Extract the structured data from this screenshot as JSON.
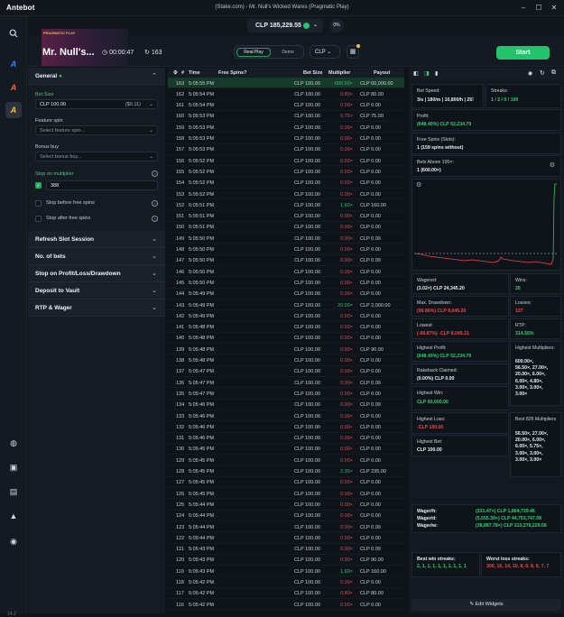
{
  "window": {
    "app_logo": "Antebot",
    "title": "(Stake.com) - Mr. Null's Wicked Wares (Pragmatic Play)"
  },
  "balance": {
    "amount": "CLP 185,229.55",
    "percent_button": "0%"
  },
  "rail": {
    "icons": [
      "search-icon",
      "a-icon-blue",
      "a-icon-orange",
      "a-icon-yellow",
      "globe-icon",
      "discord-icon",
      "table-icon",
      "warning-icon",
      "bell-icon"
    ],
    "version": "14.2"
  },
  "game": {
    "provider_tag": "PRAGMATIC PLAY",
    "name": "Mr. Null's...",
    "timer": "00:00:47",
    "spin_count": "163",
    "real_play_label": "Real Play",
    "demo_label": "Demo",
    "currency": "CLP",
    "start_label": "Start"
  },
  "settings": {
    "general_label": "General",
    "bet_size_label": "Bet Size",
    "bet_size_value": "CLP 100.00",
    "bet_size_usd": "($0.11)",
    "feature_spin_label": "Feature spin",
    "feature_spin_placeholder": "Select feature spin...",
    "bonus_buy_label": "Bonus buy",
    "bonus_buy_placeholder": "Select bonus buy...",
    "stop_on_multiplier_label": "Stop on multiplier",
    "stop_on_multiplier_value": "388",
    "stop_before_free_spins": "Stop before free spins",
    "stop_after_free_spins": "Stop after free spins",
    "sections": [
      "Refresh Slot Session",
      "No. of bets",
      "Stop on Profit/Loss/Drawdown",
      "Deposit to Vault",
      "RTP & Wager"
    ]
  },
  "table": {
    "headers": {
      "num": "#",
      "time": "Time",
      "free_spins": "Free Spins?",
      "bet_size": "Bet Size",
      "multiplier": "Multiplier",
      "payout": "Payout"
    },
    "rows": [
      [
        "163",
        "5:05:55 PM",
        "CLP 100.00",
        "600.00×",
        "CLP 60,000.00",
        "green"
      ],
      [
        "162",
        "5:05:54 PM",
        "CLP 100.00",
        "0.80×",
        "CLP 80.00",
        "red"
      ],
      [
        "161",
        "5:05:54 PM",
        "CLP 100.00",
        "0.00×",
        "CLP 0.00",
        "red"
      ],
      [
        "160",
        "5:05:53 PM",
        "CLP 100.00",
        "0.75×",
        "CLP 75.00",
        "red"
      ],
      [
        "159",
        "5:05:53 PM",
        "CLP 100.00",
        "0.00×",
        "CLP 0.00",
        "red"
      ],
      [
        "158",
        "5:05:53 PM",
        "CLP 100.00",
        "0.00×",
        "CLP 0.00",
        "red"
      ],
      [
        "157",
        "5:05:53 PM",
        "CLP 100.00",
        "0.00×",
        "CLP 0.00",
        "red"
      ],
      [
        "156",
        "5:05:52 PM",
        "CLP 100.00",
        "0.00×",
        "CLP 0.00",
        "red"
      ],
      [
        "155",
        "5:05:52 PM",
        "CLP 100.00",
        "0.00×",
        "CLP 0.00",
        "red"
      ],
      [
        "154",
        "5:05:52 PM",
        "CLP 100.00",
        "0.00×",
        "CLP 0.00",
        "red"
      ],
      [
        "153",
        "5:05:52 PM",
        "CLP 100.00",
        "0.00×",
        "CLP 0.00",
        "red"
      ],
      [
        "152",
        "5:05:51 PM",
        "CLP 100.00",
        "1.60×",
        "CLP 160.00",
        "green"
      ],
      [
        "151",
        "5:05:51 PM",
        "CLP 100.00",
        "0.00×",
        "CLP 0.00",
        "red"
      ],
      [
        "150",
        "5:05:51 PM",
        "CLP 100.00",
        "0.00×",
        "CLP 0.00",
        "red"
      ],
      [
        "149",
        "5:05:50 PM",
        "CLP 100.00",
        "0.00×",
        "CLP 0.00",
        "red"
      ],
      [
        "148",
        "5:05:50 PM",
        "CLP 100.00",
        "0.00×",
        "CLP 0.00",
        "red"
      ],
      [
        "147",
        "5:05:50 PM",
        "CLP 100.00",
        "0.00×",
        "CLP 0.00",
        "red"
      ],
      [
        "146",
        "5:05:50 PM",
        "CLP 100.00",
        "0.00×",
        "CLP 0.00",
        "red"
      ],
      [
        "145",
        "5:05:50 PM",
        "CLP 100.00",
        "0.00×",
        "CLP 0.00",
        "red"
      ],
      [
        "144",
        "5:05:49 PM",
        "CLP 100.00",
        "0.00×",
        "CLP 0.00",
        "red"
      ],
      [
        "143",
        "5:05:49 PM",
        "CLP 100.00",
        "20.00×",
        "CLP 2,000.00",
        "green"
      ],
      [
        "142",
        "5:05:49 PM",
        "CLP 100.00",
        "0.00×",
        "CLP 0.00",
        "red"
      ],
      [
        "141",
        "5:05:48 PM",
        "CLP 100.00",
        "0.00×",
        "CLP 0.00",
        "red"
      ],
      [
        "140",
        "5:05:48 PM",
        "CLP 100.00",
        "0.00×",
        "CLP 0.00",
        "red"
      ],
      [
        "139",
        "5:05:48 PM",
        "CLP 100.00",
        "0.90×",
        "CLP 90.00",
        "red"
      ],
      [
        "138",
        "5:05:48 PM",
        "CLP 100.00",
        "0.00×",
        "CLP 0.00",
        "red"
      ],
      [
        "137",
        "5:05:47 PM",
        "CLP 100.00",
        "0.00×",
        "CLP 0.00",
        "red"
      ],
      [
        "136",
        "5:05:47 PM",
        "CLP 100.00",
        "0.00×",
        "CLP 0.00",
        "red"
      ],
      [
        "135",
        "5:05:47 PM",
        "CLP 100.00",
        "0.00×",
        "CLP 0.00",
        "red"
      ],
      [
        "134",
        "5:05:46 PM",
        "CLP 100.00",
        "0.00×",
        "CLP 0.00",
        "red"
      ],
      [
        "133",
        "5:05:46 PM",
        "CLP 100.00",
        "0.00×",
        "CLP 0.00",
        "red"
      ],
      [
        "132",
        "5:05:46 PM",
        "CLP 100.00",
        "0.00×",
        "CLP 0.00",
        "red"
      ],
      [
        "131",
        "5:05:46 PM",
        "CLP 100.00",
        "0.00×",
        "CLP 0.00",
        "red"
      ],
      [
        "130",
        "5:05:45 PM",
        "CLP 100.00",
        "0.00×",
        "CLP 0.00",
        "red"
      ],
      [
        "129",
        "5:05:45 PM",
        "CLP 100.00",
        "0.00×",
        "CLP 0.00",
        "red"
      ],
      [
        "128",
        "5:05:45 PM",
        "CLP 100.00",
        "2.35×",
        "CLP 235.00",
        "green"
      ],
      [
        "127",
        "5:05:45 PM",
        "CLP 100.00",
        "0.00×",
        "CLP 0.00",
        "red"
      ],
      [
        "126",
        "5:05:45 PM",
        "CLP 100.00",
        "0.00×",
        "CLP 0.00",
        "red"
      ],
      [
        "125",
        "5:05:44 PM",
        "CLP 100.00",
        "0.00×",
        "CLP 0.00",
        "red"
      ],
      [
        "124",
        "5:05:44 PM",
        "CLP 100.00",
        "0.00×",
        "CLP 0.00",
        "red"
      ],
      [
        "123",
        "5:05:44 PM",
        "CLP 100.00",
        "0.00×",
        "CLP 0.00",
        "red"
      ],
      [
        "122",
        "5:05:44 PM",
        "CLP 100.00",
        "0.00×",
        "CLP 0.00",
        "red"
      ],
      [
        "121",
        "5:05:43 PM",
        "CLP 100.00",
        "0.00×",
        "CLP 0.00",
        "red"
      ],
      [
        "120",
        "5:05:43 PM",
        "CLP 100.00",
        "0.90×",
        "CLP 90.00",
        "red"
      ],
      [
        "119",
        "5:05:43 PM",
        "CLP 100.00",
        "1.60×",
        "CLP 160.00",
        "green"
      ],
      [
        "118",
        "5:05:42 PM",
        "CLP 100.00",
        "0.00×",
        "CLP 0.00",
        "red"
      ],
      [
        "117",
        "5:05:42 PM",
        "CLP 100.00",
        "0.80×",
        "CLP 80.00",
        "red"
      ],
      [
        "116",
        "5:05:42 PM",
        "CLP 100.00",
        "0.00×",
        "CLP 0.00",
        "red"
      ]
    ]
  },
  "stats": {
    "bet_speed_label": "Bet Speed:",
    "bet_speed_value": "3/s | 180/m | 10,800/h | 25!",
    "streaks_label": "Streaks:",
    "streaks_value": "1 / 2 / 0 / 100",
    "profit_label": "Profit:",
    "profit_value": "(648.40%) CLP 52,234.79",
    "free_spins_label": "Free Spins (Slots):",
    "free_spins_value": "1 (159 spins without)",
    "bets_above_label": "Bets Above 100×:",
    "bets_above_value": "1 (600.00×)",
    "wagered_label": "Wagered:",
    "wagered_value": "(3.02×) CLP 24,345.20",
    "wins_label": "Wins:",
    "wins_value": "26",
    "max_drawdown_label": "Max. Drawdown:",
    "max_drawdown_value": "(99.86%) CLP 8,045.20",
    "losses_label": "Losses:",
    "losses_value": "137",
    "lowest_label": "Lowest:",
    "lowest_value": "(-99.87%) -CLP 8,045.21",
    "rtp_label": "RTP:",
    "rtp_value": "314.55%",
    "highest_profit_label": "Highest Profit:",
    "highest_profit_value": "(648.40%) CLP 52,234.79",
    "highest_multipliers_label": "Highest Multipliers:",
    "highest_multipliers_value": [
      "600.00×,",
      "56.50×, 27.00×,",
      "20.00×, 6.00×,",
      "6.00×, 4.80×,",
      "3.00×, 3.00×,",
      "3.00×"
    ],
    "rakeback_label": "Rakeback Claimed:",
    "rakeback_value": "(0.00%) CLP 0.00",
    "highest_win_label": "Highest Win:",
    "highest_win_value": "CLP 60,000.00",
    "highest_loss_label": "Highest Loss:",
    "highest_loss_value": "-CLP 100.00",
    "best_multipliers_label": "Best 826 Multipliers",
    "best_multipliers_value": [
      "56.50×, 27.00×,",
      "20.00×, 6.00×,",
      "6.00×, 5.75×,",
      "3.00×, 3.00×,",
      "3.00×, 3.00×"
    ],
    "highest_bet_label": "Highest Bet:",
    "highest_bet_value": "CLP 100.00",
    "wager_h_label": "Wager/h:",
    "wager_h_value": "(231.47×) CLP 1,864,739.46",
    "wager_d_label": "Wager/d:",
    "wager_d_value": "(5,555.39×) CLP 44,753,747.08",
    "wager_w_label": "Wager/w:",
    "wager_w_value": "(38,887.78×) CLP 313,276,229.56",
    "best_win_streaks_label": "Best win streaks:",
    "best_win_streaks_value": "2, 1, 1, 1, 1, 1, 1, 1, 1, 1",
    "worst_loss_streaks_label": "Worst loss streaks:",
    "worst_loss_streaks_value": "300, 16, 14, 10, 8, 8, 8, 8, 7, 7",
    "edit_widgets_label": "Edit Widgets"
  },
  "colors": {
    "accent_green": "#22c36a",
    "loss_red": "#ef4747",
    "bg": "#0f141b"
  }
}
